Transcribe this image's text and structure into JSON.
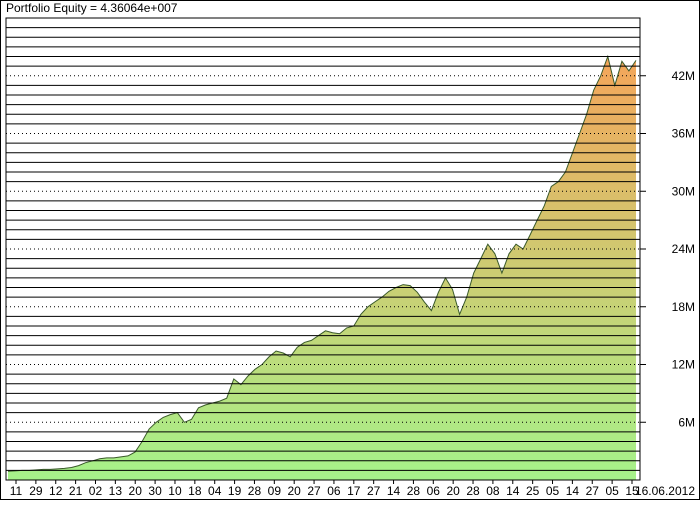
{
  "chart_data": {
    "type": "area",
    "title": "Portfolio Equity = 4.36064e+007",
    "xlabel": "",
    "ylabel": "",
    "ylim": [
      0,
      48
    ],
    "y_axis_side": "right",
    "y_unit_suffix": "M",
    "y_ticks": [
      6,
      12,
      18,
      24,
      30,
      36,
      42
    ],
    "y_tick_labels": [
      "6M",
      "12M",
      "18M",
      "24M",
      "30M",
      "36M",
      "42M"
    ],
    "x_tick_labels": [
      "11",
      "29",
      "12",
      "21",
      "02",
      "13",
      "20",
      "30",
      "10",
      "18",
      "04",
      "19",
      "28",
      "09",
      "20",
      "27",
      "06",
      "17",
      "27",
      "14",
      "28",
      "06",
      "20",
      "28",
      "08",
      "14",
      "25",
      "05",
      "14",
      "27",
      "05",
      "15"
    ],
    "x_end_label": "16.06.2012",
    "grid": true,
    "fill_gradient": {
      "low": "#a6f28a",
      "high": "#f4a55a"
    },
    "line_color": "#3a5a2a",
    "series": [
      {
        "values": [
          0.9,
          0.95,
          1.0,
          1.0,
          1.05,
          1.1,
          1.1,
          1.15,
          1.2,
          1.3,
          1.5,
          1.8,
          2.0,
          2.2,
          2.3,
          2.3,
          2.4,
          2.5,
          2.9,
          4.0,
          5.3,
          6.0,
          6.5,
          6.8,
          7.0,
          6.0,
          6.3,
          7.5,
          7.8,
          8.0,
          8.2,
          8.5,
          10.5,
          9.9,
          10.8,
          11.5,
          12.0,
          12.8,
          13.4,
          13.2,
          12.8,
          13.8,
          14.3,
          14.5,
          15.0,
          15.5,
          15.3,
          15.2,
          15.8,
          16.0,
          17.2,
          18.0,
          18.5,
          19.0,
          19.6,
          20.0,
          20.3,
          20.2,
          19.5,
          18.5,
          17.6,
          19.5,
          21.0,
          19.8,
          17.2,
          19.0,
          21.5,
          23.0,
          24.5,
          23.5,
          21.5,
          23.5,
          24.5,
          24.0,
          25.5,
          27.0,
          28.5,
          30.5,
          31.0,
          32.0,
          34.0,
          36.0,
          38.0,
          40.5,
          42.0,
          44.0,
          41.0,
          43.5,
          42.5,
          43.6
        ]
      }
    ]
  }
}
